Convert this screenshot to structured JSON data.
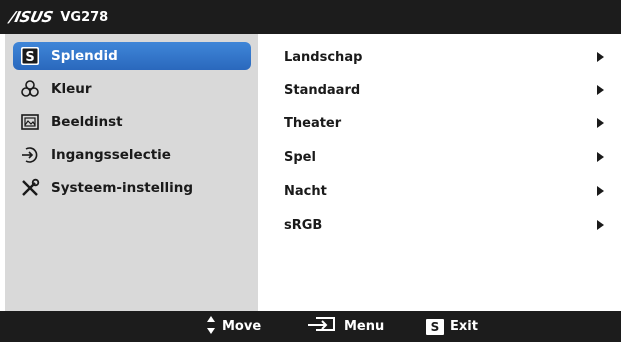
{
  "header": {
    "brand": "/ISUS",
    "model": "VG278"
  },
  "main_menu": {
    "items": [
      {
        "label": "Splendid",
        "icon": "splendid-s-icon",
        "selected": true
      },
      {
        "label": "Kleur",
        "icon": "color-circles-icon",
        "selected": false
      },
      {
        "label": "Beeldinst",
        "icon": "image-picture-icon",
        "selected": false
      },
      {
        "label": "Ingangsselectie",
        "icon": "input-arrow-icon",
        "selected": false
      },
      {
        "label": "Systeem-instelling",
        "icon": "tools-icon",
        "selected": false
      }
    ]
  },
  "sub_menu": {
    "items": [
      {
        "label": "Landschap"
      },
      {
        "label": "Standaard"
      },
      {
        "label": "Theater"
      },
      {
        "label": "Spel"
      },
      {
        "label": "Nacht"
      },
      {
        "label": "sRGB"
      }
    ]
  },
  "footer": {
    "move_label": "Move",
    "menu_label": "Menu",
    "exit_label": "Exit",
    "exit_key": "S"
  },
  "colors": {
    "bar_background": "#1c1c1c",
    "left_panel": "#d9d9d9",
    "selection": "#2f73c8",
    "text": "#1a1a1a"
  }
}
